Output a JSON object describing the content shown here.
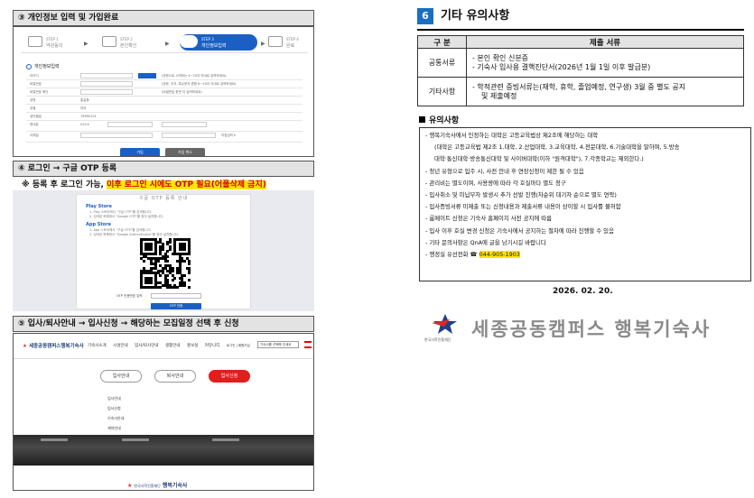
{
  "left": {
    "section1": {
      "title": "③ 개인정보 입력 및 가입완료",
      "steps": [
        {
          "num": "STEP 1",
          "name": "약관동의"
        },
        {
          "num": "STEP 2",
          "name": "본인확인"
        },
        {
          "num": "STEP 3",
          "name": "개인정보입력"
        },
        {
          "num": "STEP 4",
          "name": "완료"
        }
      ],
      "arrow": "▶",
      "form_title": "개인정보입력",
      "fields": [
        {
          "label": "아이디",
          "note": "(영문으로 시작하는 4~20자 이내로 입력하세요)"
        },
        {
          "label": "비밀번호",
          "note": "(영문, 숫자, 특수문자 혼용 8~20자 이내로 입력하세요)"
        },
        {
          "label": "비밀번호 확인",
          "note": "(비밀번호 한번 더 입력하세요)"
        },
        {
          "label": "성명",
          "value": "홍길동"
        },
        {
          "label": "성별",
          "value": "여자"
        },
        {
          "label": "생년월일",
          "value": "19990101"
        },
        {
          "label": "휴대폰",
          "value": "010 ▾"
        },
        {
          "label": "이메일",
          "value": "직접입력 ▾"
        }
      ],
      "join_button": "가입",
      "cancel_button": "가입 취소",
      "up_button": "↑"
    },
    "section2": {
      "title": "④ 로그인 → 구글 OTP 등록",
      "note_prefix": "※ 등록 후 로그인 가능, ",
      "note_highlight": "이후 로그인 시에도 OTP 필요(어플삭제 금지)",
      "card_title": "구글 OTP 등록 안내",
      "play_store": "Play Store",
      "play_lines": [
        "1. Play 스토어에서 \"구글 OTP\"를 검색합니다.",
        "2. 검색된 목록에서 \"Google OTP\"를 찾아 설치합니다."
      ],
      "app_store": "App Store",
      "app_lines": [
        "1. App 스토어에서 \"구글 OTP\"를 검색합니다.",
        "2. 검색된 목록에서 \"Google Authenticator\"를 찾아 설치합니다."
      ],
      "otp_label": "OTP 인증번호 입력",
      "otp_button": "OTP 인증"
    },
    "section3": {
      "title": "⑤ 입사/퇴사안내 → 입사신청 → 해당하는 모집일정 선택 후 신청",
      "logo": "세종공동캠퍼스행복기숙사",
      "nav": [
        "기숙사소개",
        "시설안내",
        "입사/퇴사안내",
        "생활안내",
        "홍보실",
        "커뮤니티"
      ],
      "login": "로그인 | 회원가입",
      "select": "기숙사를 선택해 주세요",
      "tabs": [
        "입사안내",
        "퇴사안내",
        "입사신청"
      ],
      "sub_items": [
        "입사안내",
        "입사신청",
        "기숙사안내",
        "계약안내"
      ],
      "footer_small": "한국사학진흥재단",
      "footer_name": "행복기숙사"
    }
  },
  "right": {
    "num": "6",
    "title": "기타 유의사항",
    "table_head": [
      "구 분",
      "제출 서류"
    ],
    "rows": [
      {
        "cat": "공통서류",
        "lines": [
          "- 본인 확인 신분증",
          "- 기숙사 입사용 결핵진단서(2026년 1월 1일 이후 발급분)"
        ]
      },
      {
        "cat": "기타사항",
        "lines": [
          "- 학적관련 증빙서류는(재학, 휴학, 졸업예정, 연구생) 3월 중 별도 공지",
          "및 제출예정"
        ]
      }
    ],
    "notice_title": "유의사항",
    "notice": [
      "- 행복기숙사에서 인정하는 대학은 고등교육법상 제2조에 해당하는 대학",
      "(대학은 고등교육법 제2조 1.대학, 2.산업대학, 3.교육대학, 4.전문대학, 6.기술대학을 말하며, 5.방송",
      "대학·통신대학·방송통신대학 및 사이버대학(이하 \"원격대학\"), 7.각종학교는 제외한다.)",
      "- 청년 유형으로 입주 시, 사전 안내 후 연장신청이 제한 될 수 있음",
      "- 관리비는 별도이며, 사용량에 따라 각 호실마다 별도 청구",
      "- 입사취소 및 미납부자 발생시 추가 선발 진행(차순위 대기자 순으로 별도 연락)",
      "- 입사증빙서류 미제출 또는 신청내용과 제출서류 내용이 상이할 시 입사를 불허함",
      "- 룸메이트 신청은 기숙사 홈페이지 사전 공지에 따름",
      "- 입사 이후 호실 변경 신청은 기숙사에서 공지하는 절차에 따라 진행할 수 있음",
      "- 기타 문의사항은 QnA에 글을 남기시길 바랍니다"
    ],
    "phone_prefix": "- 행정실 유선전화 ☎ ",
    "phone": "044-905-1903",
    "date": "2026. 02. 20.",
    "logo_small": "한국사학진흥재단",
    "logo_name": "세종공동캠퍼스 행복기숙사"
  }
}
